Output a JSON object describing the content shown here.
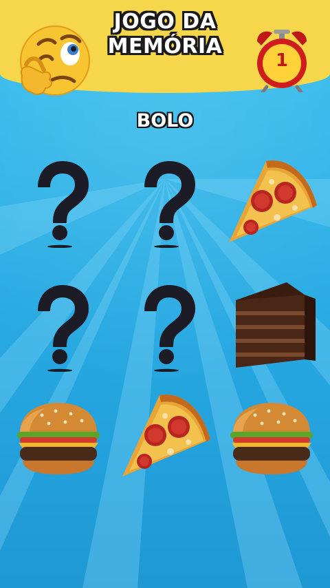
{
  "header": {
    "title_line1": "JOGO DA",
    "title_line2": "MEMÓRIA",
    "left_icon": "thinking-face-emoji-icon",
    "timer_icon": "alarm-clock-icon",
    "timer_value": "1"
  },
  "prompt": {
    "target_word": "BOLO"
  },
  "board": {
    "cards": [
      {
        "state": "hidden",
        "face": "question-mark-icon"
      },
      {
        "state": "hidden",
        "face": "question-mark-icon"
      },
      {
        "state": "revealed",
        "face": "pizza-slice-icon"
      },
      {
        "state": "hidden",
        "face": "question-mark-icon"
      },
      {
        "state": "hidden",
        "face": "question-mark-icon"
      },
      {
        "state": "revealed",
        "face": "chocolate-cake-slice-icon"
      },
      {
        "state": "revealed",
        "face": "hamburger-icon"
      },
      {
        "state": "revealed",
        "face": "pizza-slice-icon"
      },
      {
        "state": "revealed",
        "face": "hamburger-icon"
      }
    ]
  },
  "colors": {
    "background": "#2bb0e8",
    "header": "#f6d64a",
    "title_text": "#ffffff",
    "outline": "#1a1a1a",
    "question_mark": "#1c1c26",
    "timer_red": "#c01818"
  }
}
